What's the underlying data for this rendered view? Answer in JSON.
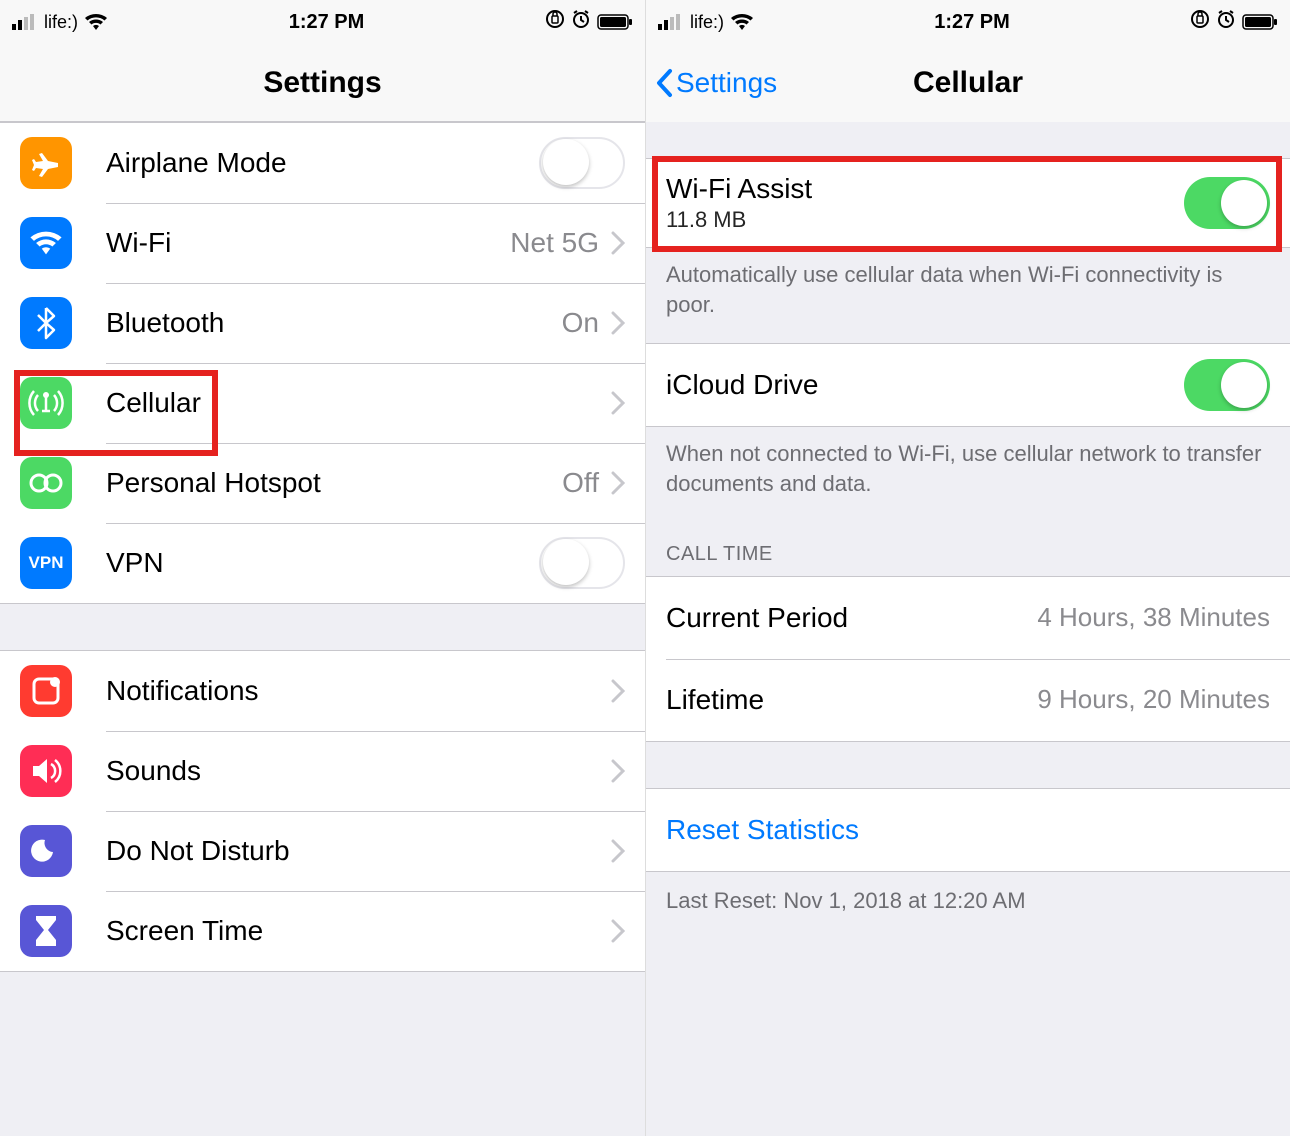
{
  "statusbar": {
    "carrier": "life:)",
    "time": "1:27 PM"
  },
  "left": {
    "title": "Settings",
    "rows": {
      "airplane": "Airplane Mode",
      "wifi": {
        "label": "Wi-Fi",
        "value": "Net 5G"
      },
      "bluetooth": {
        "label": "Bluetooth",
        "value": "On"
      },
      "cellular": "Cellular",
      "hotspot": {
        "label": "Personal Hotspot",
        "value": "Off"
      },
      "vpn": "VPN",
      "notifications": "Notifications",
      "sounds": "Sounds",
      "dnd": "Do Not Disturb",
      "screentime": "Screen Time"
    }
  },
  "right": {
    "back": "Settings",
    "title": "Cellular",
    "wifiAssist": {
      "label": "Wi-Fi Assist",
      "sub": "11.8 MB"
    },
    "wifiAssistFooter": "Automatically use cellular data when Wi-Fi connectivity is poor.",
    "icloud": "iCloud Drive",
    "icloudFooter": "When not connected to Wi-Fi, use cellular network to transfer documents and data.",
    "callTimeHeader": "CALL TIME",
    "currentPeriod": {
      "label": "Current Period",
      "value": "4 Hours, 38 Minutes"
    },
    "lifetime": {
      "label": "Lifetime",
      "value": "9 Hours, 20 Minutes"
    },
    "reset": "Reset Statistics",
    "lastReset": "Last Reset: Nov 1, 2018 at 12:20 AM"
  },
  "colors": {
    "orange": "#ff9500",
    "blue": "#007aff",
    "green": "#4cd964",
    "red": "#ff3b30",
    "pink": "#ff2d55",
    "purple": "#5856d6"
  }
}
